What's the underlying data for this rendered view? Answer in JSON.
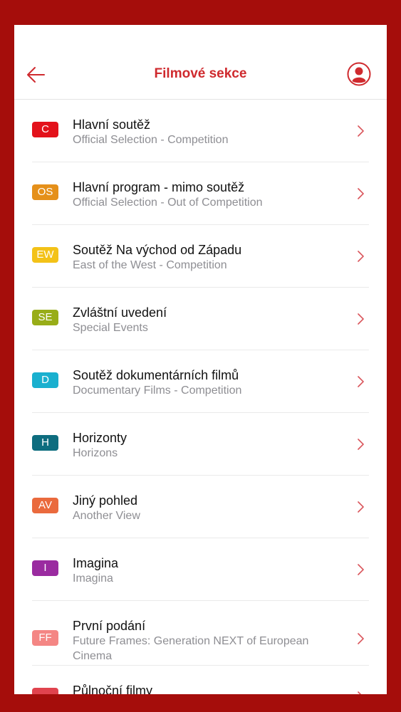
{
  "header": {
    "title": "Filmové sekce",
    "back_icon": "arrow-left-icon",
    "profile_icon": "user-circle-icon",
    "accent": "#cf2a2e"
  },
  "sections": [
    {
      "code": "C",
      "color": "#e3121b",
      "name": "Hlavní soutěž",
      "subtitle": "Official Selection - Competition"
    },
    {
      "code": "OS",
      "color": "#e5901a",
      "name": "Hlavní program - mimo soutěž",
      "subtitle": "Official Selection - Out of Competition"
    },
    {
      "code": "EW",
      "color": "#f3c218",
      "name": "Soutěž Na východ od Západu",
      "subtitle": "East of the West - Competition"
    },
    {
      "code": "SE",
      "color": "#98ad18",
      "name": "Zvláštní uvedení",
      "subtitle": "Special Events"
    },
    {
      "code": "D",
      "color": "#1ab0cf",
      "name": "Soutěž dokumentárních filmů",
      "subtitle": "Documentary Films - Competition"
    },
    {
      "code": "H",
      "color": "#0e6d7f",
      "name": "Horizonty",
      "subtitle": "Horizons"
    },
    {
      "code": "AV",
      "color": "#ea6a3d",
      "name": "Jiný pohled",
      "subtitle": "Another View"
    },
    {
      "code": "I",
      "color": "#9a2ba0",
      "name": "Imagina",
      "subtitle": "Imagina"
    },
    {
      "code": "FF",
      "color": "#f48684",
      "name": "První podání",
      "subtitle": "Future Frames: Generation NEXT of European Cinema"
    },
    {
      "code": "",
      "color": "#e0434e",
      "name": "Půlnoční filmy",
      "subtitle": ""
    }
  ]
}
